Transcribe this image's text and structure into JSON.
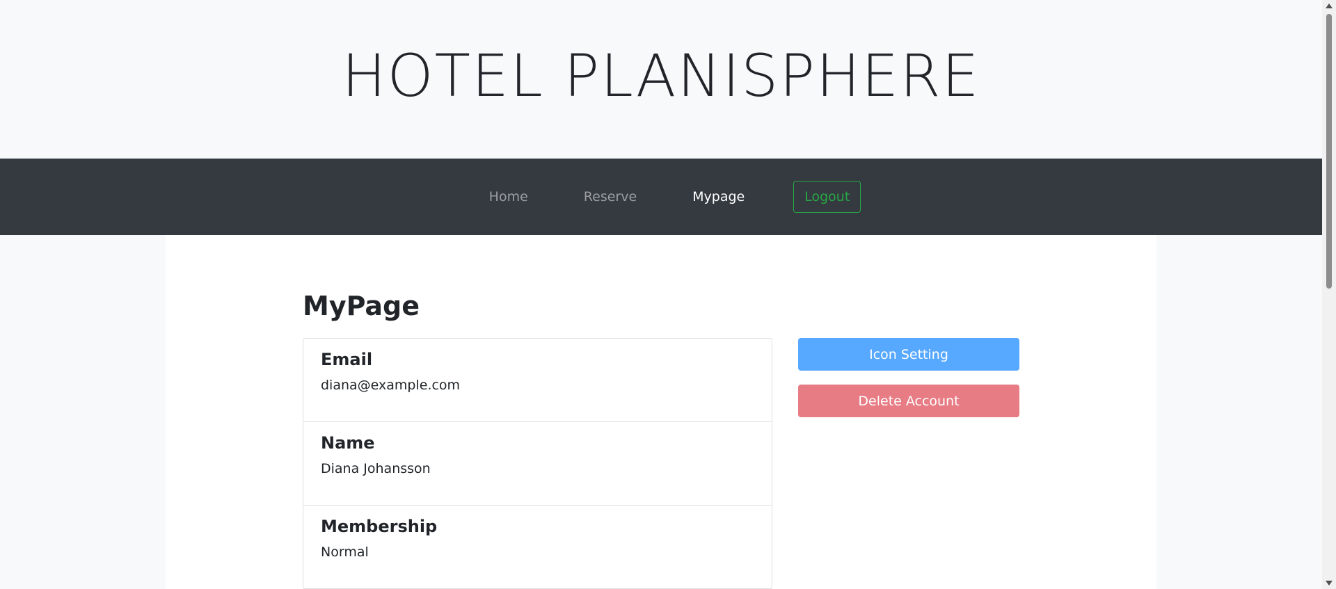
{
  "hero": {
    "title": "HOTEL PLANISPHERE"
  },
  "nav": {
    "items": [
      {
        "label": "Home",
        "active": false
      },
      {
        "label": "Reserve",
        "active": false
      },
      {
        "label": "Mypage",
        "active": true
      }
    ],
    "logout_label": "Logout"
  },
  "main": {
    "heading": "MyPage",
    "fields": [
      {
        "label": "Email",
        "value": "diana@example.com"
      },
      {
        "label": "Name",
        "value": "Diana Johansson"
      },
      {
        "label": "Membership",
        "value": "Normal"
      }
    ],
    "buttons": {
      "icon_setting": "Icon Setting",
      "delete_account": "Delete Account"
    }
  },
  "colors": {
    "navbar": "#343a40",
    "success": "#28a745",
    "primary": "#57a8ff",
    "danger": "#e87c85"
  },
  "icons": {
    "scroll_up": "scroll-up-arrow-icon",
    "scroll_down": "scroll-down-arrow-icon"
  }
}
